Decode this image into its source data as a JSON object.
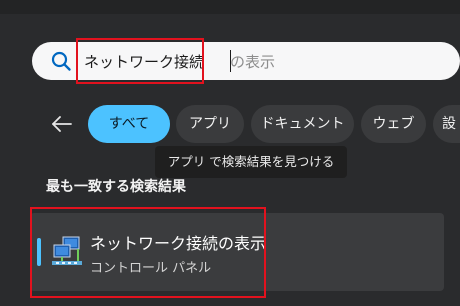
{
  "search": {
    "typed_text": "ネットワーク接続",
    "suggestion_text": "の表示"
  },
  "tabs": [
    {
      "label": "すべて",
      "active": true
    },
    {
      "label": "アプリ",
      "active": false
    },
    {
      "label": "ドキュメント",
      "active": false
    },
    {
      "label": "ウェブ",
      "active": false
    },
    {
      "label": "設",
      "active": false
    }
  ],
  "tooltip": "アプリ で検索結果を見つける",
  "section_title": "最も一致する検索結果",
  "best_match": {
    "title": "ネットワーク接続の表示",
    "subtitle": "コントロール パネル"
  },
  "colors": {
    "accent": "#4cc2ff",
    "highlight": "#e2121e"
  },
  "icons": {
    "search": "search-icon",
    "back": "back-arrow-icon",
    "result": "network-connections-icon"
  }
}
